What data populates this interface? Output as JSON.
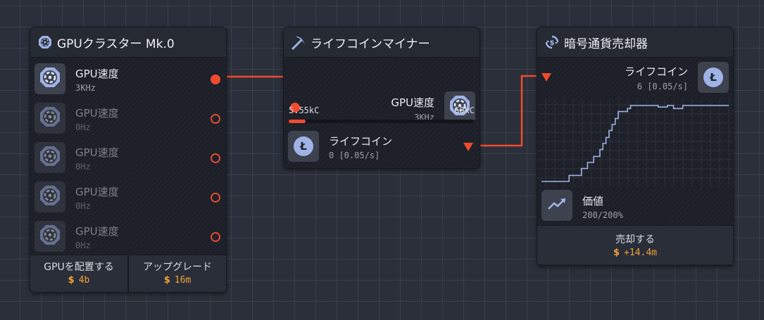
{
  "cluster": {
    "title": "GPUクラスター Mk.0",
    "slots": [
      {
        "label": "GPU速度",
        "value": "3KHz"
      },
      {
        "label": "GPU速度",
        "value": "0Hz"
      },
      {
        "label": "GPU速度",
        "value": "0Hz"
      },
      {
        "label": "GPU速度",
        "value": "0Hz"
      },
      {
        "label": "GPU速度",
        "value": "0Hz"
      }
    ],
    "place_button": {
      "label": "GPUを配置する",
      "currency": "$",
      "cost": "4b"
    },
    "upgrade_button": {
      "label": "アップグレード",
      "currency": "$",
      "cost": "16m"
    }
  },
  "miner": {
    "title": "ライフコインマイナー",
    "input_label": "GPU速度",
    "input_value": "3KHz",
    "progress_current": "5.55kC",
    "progress_max": "60kC",
    "progress_fraction": 0.0925,
    "output_label": "ライフコイン",
    "output_value": "0 [0.05/s]",
    "coin_symbol": "Ł"
  },
  "seller": {
    "title": "暗号通貨売却器",
    "input_label": "ライフコイン",
    "input_value": "6 [0.05/s]",
    "coin_symbol": "Ł",
    "value_label": "価値",
    "value_value": "200/200%",
    "sell_label": "売却する",
    "sell_currency": "$",
    "sell_amount": "+14.4m"
  },
  "price_history": [
    0,
    0,
    0,
    0,
    0,
    0,
    0,
    0,
    0,
    8,
    8,
    8,
    8,
    17,
    17,
    25,
    25,
    33,
    33,
    42,
    50,
    58,
    67,
    75,
    83,
    92,
    92,
    92,
    96,
    100,
    100,
    100,
    100,
    100,
    100,
    100,
    100,
    100,
    98,
    98,
    98,
    100,
    100,
    96,
    96,
    96,
    100,
    100,
    100,
    100,
    100,
    100,
    100,
    100,
    100,
    100,
    100,
    100,
    100,
    100,
    100,
    100
  ],
  "colors": {
    "accent": "#f04a2f",
    "coin": "#9fb3e6",
    "money": "#f2a33a",
    "chart_line": "#9fb3e6"
  }
}
